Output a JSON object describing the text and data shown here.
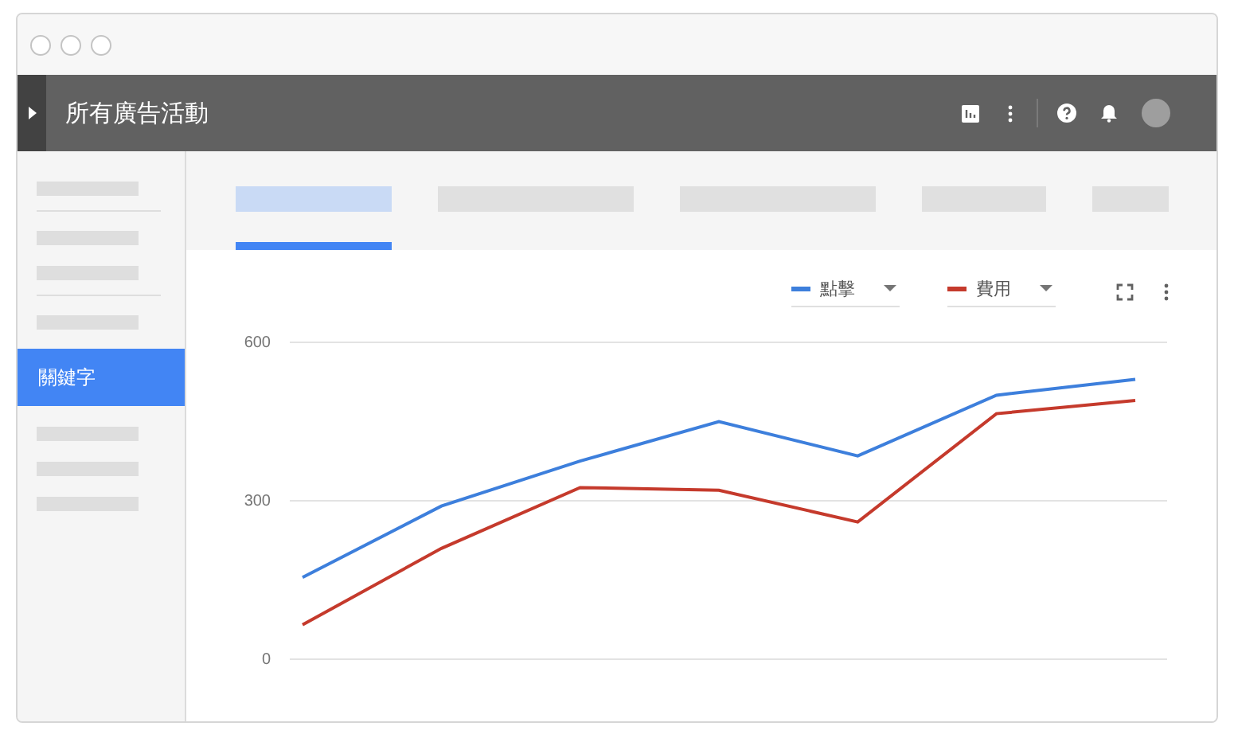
{
  "header": {
    "title": "所有廣告活動"
  },
  "sidebar": {
    "items": [
      {
        "kind": "placeholder"
      },
      {
        "kind": "divider"
      },
      {
        "kind": "placeholder"
      },
      {
        "kind": "placeholder"
      },
      {
        "kind": "divider"
      },
      {
        "kind": "placeholder"
      },
      {
        "kind": "item",
        "label": "關鍵字",
        "selected": true
      },
      {
        "kind": "placeholder"
      },
      {
        "kind": "placeholder"
      },
      {
        "kind": "placeholder"
      }
    ]
  },
  "tabs": [
    {
      "selected": true
    },
    {
      "selected": false
    },
    {
      "selected": false
    },
    {
      "selected": false
    },
    {
      "selected": false
    }
  ],
  "chart": {
    "chart_data": {
      "type": "line",
      "ylim": [
        0,
        600
      ],
      "yticks": [
        0,
        300,
        600
      ],
      "series": [
        {
          "name": "點擊",
          "color": "#3d7fdc",
          "values": [
            155,
            290,
            375,
            450,
            385,
            500,
            530
          ]
        },
        {
          "name": "費用",
          "color": "#c53a2c",
          "values": [
            65,
            210,
            325,
            320,
            260,
            465,
            490
          ]
        }
      ]
    }
  }
}
